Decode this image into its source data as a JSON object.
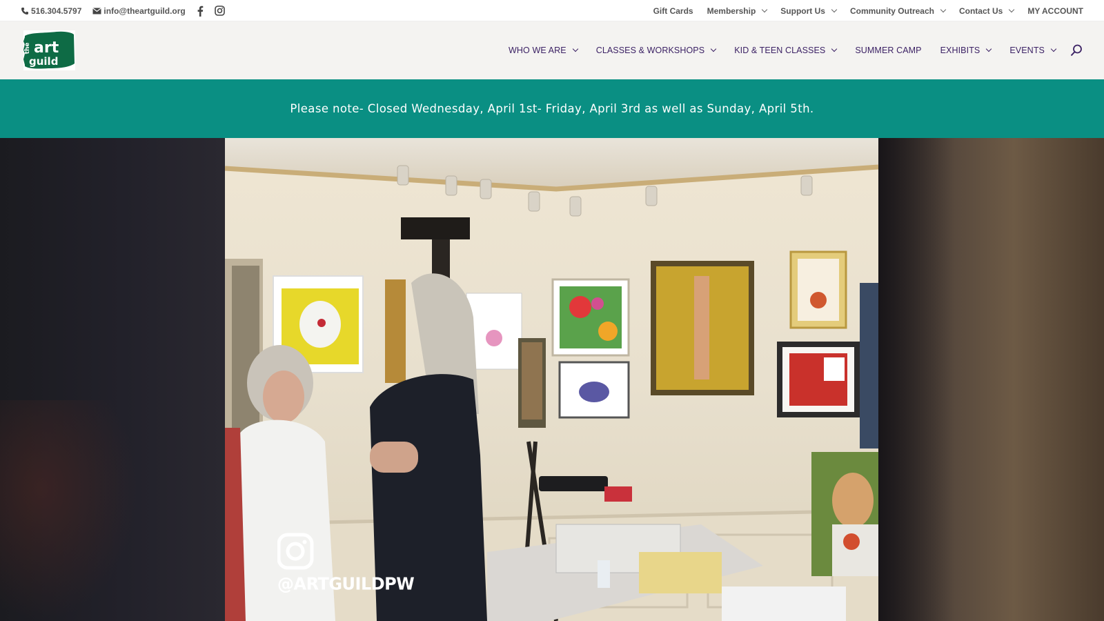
{
  "topbar": {
    "phone": "516.304.5797",
    "email": "info@theartguild.org",
    "social_icons": [
      "facebook-icon",
      "instagram-icon"
    ],
    "nav": [
      {
        "label": "Gift Cards",
        "has_dropdown": false
      },
      {
        "label": "Membership",
        "has_dropdown": true
      },
      {
        "label": "Support Us",
        "has_dropdown": true
      },
      {
        "label": "Community Outreach",
        "has_dropdown": true
      },
      {
        "label": "Contact Us",
        "has_dropdown": true
      },
      {
        "label": "MY ACCOUNT",
        "has_dropdown": false
      }
    ]
  },
  "header": {
    "logo": {
      "line1": "the",
      "line2": "art",
      "line3": "guild"
    },
    "nav": [
      {
        "label": "WHO WE ARE",
        "has_dropdown": true
      },
      {
        "label": "CLASSES & WORKSHOPS",
        "has_dropdown": true
      },
      {
        "label": "KID & TEEN CLASSES",
        "has_dropdown": true
      },
      {
        "label": "SUMMER CAMP",
        "has_dropdown": false
      },
      {
        "label": "EXHIBITS",
        "has_dropdown": false
      },
      {
        "label": "EVENTS",
        "has_dropdown": true
      }
    ],
    "search_icon": "search-icon"
  },
  "notice": {
    "text": "Please note- Closed Wednesday, April 1st- Friday, April 3rd as well as Sunday, April 5th."
  },
  "hero": {
    "instagram_handle": "@ARTGUILDPW"
  },
  "colors": {
    "notice_bg": "#0a8f83",
    "nav_text": "#3b2164",
    "logo_green": "#0e6b45"
  }
}
